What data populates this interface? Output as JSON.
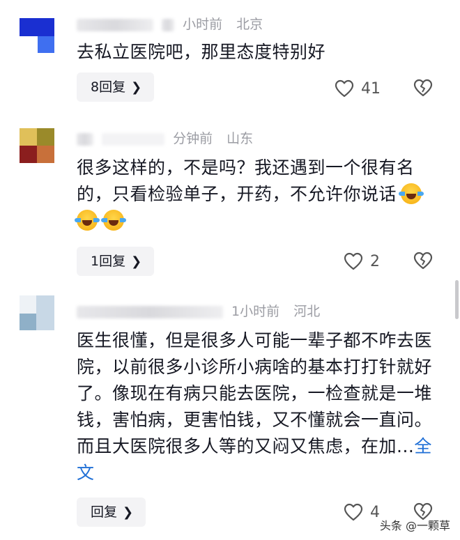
{
  "comments": [
    {
      "time": "小时前",
      "location": "北京",
      "text": "去私立医院吧，那里态度特别好",
      "reply_label": "8回复",
      "likes": "41",
      "avatar_colors": [
        "#1a2fd1",
        "#3f6ff0",
        "#ffffff"
      ]
    },
    {
      "time": "分钟前",
      "location": "山东",
      "text": "很多这样的，不是吗？我还遇到一个很有名的，只看检验单子，开药，不允许你说话",
      "reply_label": "1回复",
      "likes": "2",
      "avatar_colors": [
        "#9a8a2a",
        "#8b1e1e",
        "#c8703a",
        "#e0c05a"
      ]
    },
    {
      "time": "1小时前",
      "location": "河北",
      "text": "医生很懂，但是很多人可能一辈子都不咋去医院，以前很多小诊所小病啥的基本打打针就好了。像现在有病只能去医院，一检查就是一堆钱，害怕病，更害怕钱，又不懂就会一直问。而且大医院很多人等的又闷又焦虑，在加...",
      "expand_label": "全文",
      "reply_label": "回复",
      "likes": "4",
      "avatar_colors": [
        "#8fb0c8",
        "#c8d8e6",
        "#eef2f6"
      ]
    }
  ],
  "icons": {
    "chevron": "chevron-right-icon",
    "like": "heart-outline-icon",
    "dislike": "broken-heart-icon",
    "emoji": "laugh-cry-emoji"
  },
  "watermark": "头条 @一颗草"
}
